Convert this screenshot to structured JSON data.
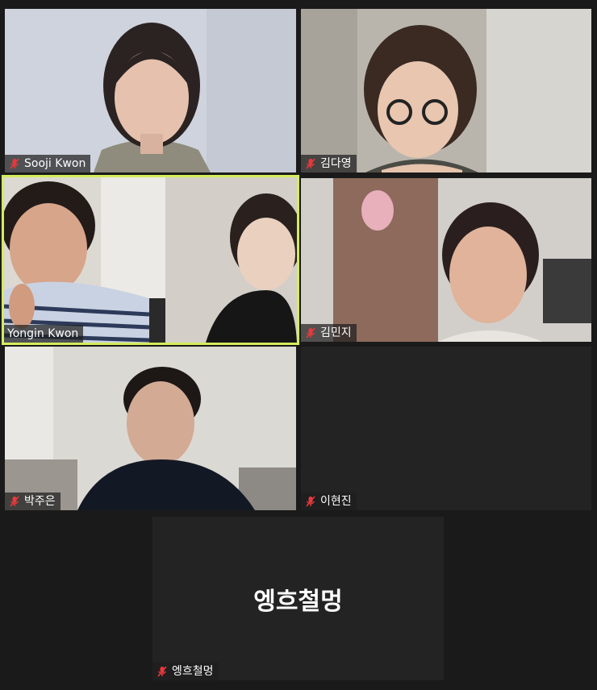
{
  "participants": [
    {
      "name": "Sooji Kwon",
      "muted": true,
      "video": true,
      "active": false
    },
    {
      "name": "김다영",
      "muted": true,
      "video": true,
      "active": false
    },
    {
      "name": "Yongin Kwon",
      "muted": false,
      "video": true,
      "active": true
    },
    {
      "name": "김민지",
      "muted": true,
      "video": true,
      "active": false
    },
    {
      "name": "박주은",
      "muted": true,
      "video": true,
      "active": false
    },
    {
      "name": "이현진",
      "muted": true,
      "video": false,
      "active": false
    },
    {
      "name": "엥흐철멍",
      "muted": true,
      "video": false,
      "active": false
    }
  ],
  "no_video_display_name": "엥흐철멍",
  "icons": {
    "mic_muted": "mic-muted-icon"
  },
  "colors": {
    "active_speaker_border": "#d4ec5c",
    "mic_muted": "#e8383b",
    "background": "#1a1a1a"
  }
}
